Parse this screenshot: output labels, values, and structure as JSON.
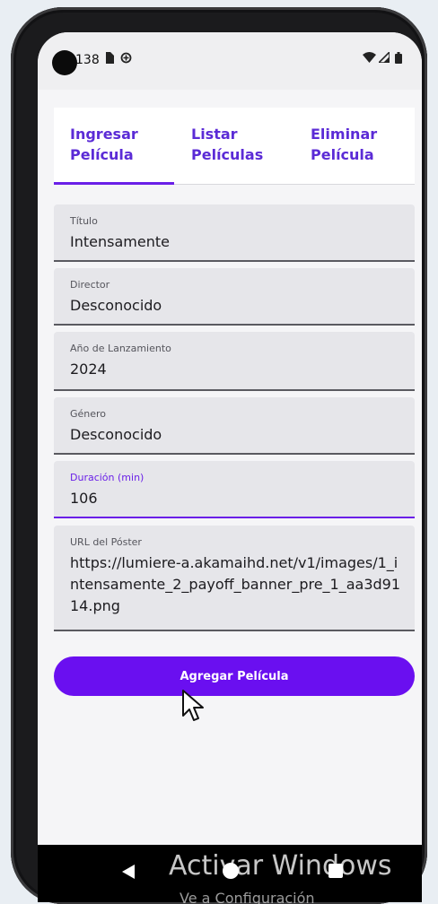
{
  "status_bar": {
    "time": "138",
    "icons": [
      "sim-card-icon",
      "data-saver-icon"
    ],
    "right_icons": [
      "wifi-icon",
      "signal-icon",
      "battery-icon"
    ]
  },
  "tabs": [
    {
      "label": "Ingresar\nPelícula",
      "selected": true
    },
    {
      "label": "Listar\nPelículas",
      "selected": false
    },
    {
      "label": "Eliminar\nPelícula",
      "selected": false
    }
  ],
  "form": {
    "titulo": {
      "label": "Título",
      "value": "Intensamente"
    },
    "director": {
      "label": "Director",
      "value": "Desconocido"
    },
    "anio": {
      "label": "Año de Lanzamiento",
      "value": "2024"
    },
    "genero": {
      "label": "Género",
      "value": "Desconocido"
    },
    "duracion": {
      "label": "Duración (min)",
      "value": "106"
    },
    "poster": {
      "label": "URL del Póster",
      "value": "https://lumiere-a.akamaihd.net/v1/images/1_intensamente_2_payoff_banner_pre_1_aa3d9114.png"
    }
  },
  "add_button_label": "Agregar Película",
  "watermark": {
    "line1": "Activar Windows",
    "line2": "Ve a Configuración"
  },
  "colors": {
    "accent": "#6a1fe8",
    "button": "#6a0ff0",
    "field_bg": "#e6e6ea"
  }
}
